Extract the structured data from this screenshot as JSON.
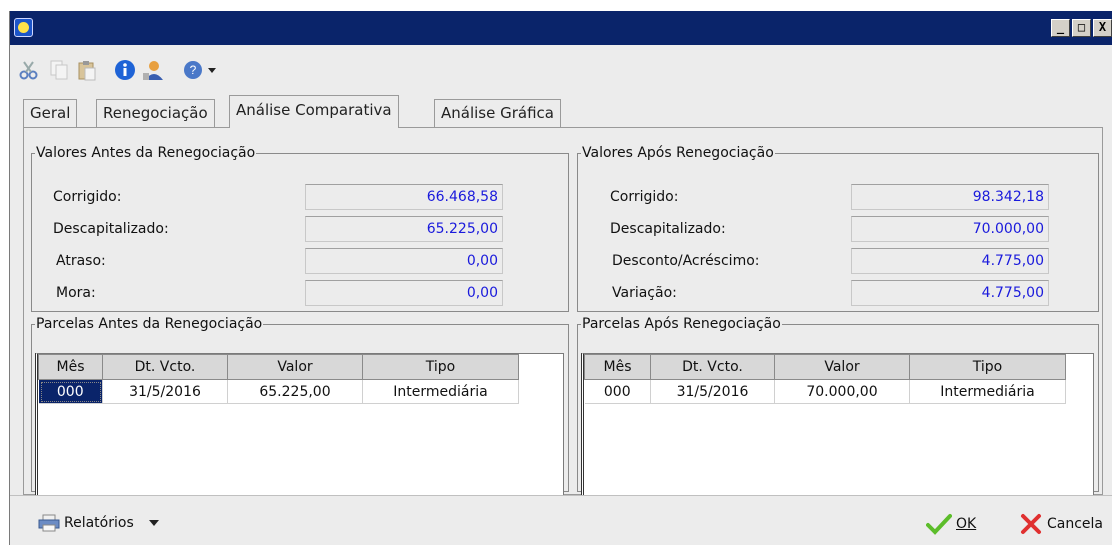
{
  "toolbar": {
    "icons": [
      "cut-icon",
      "copy-icon",
      "paste-icon",
      "info-icon",
      "user-icon",
      "help-icon",
      "dropdown-arrow-icon"
    ]
  },
  "tabs": [
    {
      "label": "Geral"
    },
    {
      "label": "Renegociação"
    },
    {
      "label": "Análise Comparativa",
      "active": true
    },
    {
      "label": "Análise Gráfica"
    }
  ],
  "antes": {
    "title": "Valores Antes da Renegociação",
    "fields": [
      {
        "label": "Corrigido:",
        "value": "66.468,58"
      },
      {
        "label": "Descapitalizado:",
        "value": "65.225,00"
      },
      {
        "label": "Atraso:",
        "value": "0,00"
      },
      {
        "label": "Mora:",
        "value": "0,00"
      }
    ]
  },
  "apos": {
    "title": "Valores Após Renegociação",
    "fields": [
      {
        "label": "Corrigido:",
        "value": "98.342,18"
      },
      {
        "label": "Descapitalizado:",
        "value": "70.000,00"
      },
      {
        "label": "Desconto/Acréscimo:",
        "value": "4.775,00"
      },
      {
        "label": "Variação:",
        "value": "4.775,00"
      }
    ]
  },
  "parcelas_antes": {
    "title": "Parcelas Antes da Renegociação",
    "columns": [
      "Mês",
      "Dt. Vcto.",
      "Valor",
      "Tipo"
    ],
    "rows": [
      [
        "000",
        "31/5/2016",
        "65.225,00",
        "Intermediária"
      ]
    ]
  },
  "parcelas_apos": {
    "title": "Parcelas Após Renegociação",
    "columns": [
      "Mês",
      "Dt. Vcto.",
      "Valor",
      "Tipo"
    ],
    "rows": [
      [
        "000",
        "31/5/2016",
        "70.000,00",
        "Intermediária"
      ]
    ]
  },
  "bottom": {
    "relatorios": "Relatórios",
    "ok": "OK",
    "cancela": "Cancela"
  },
  "window_buttons": [
    "_",
    "□",
    "X"
  ]
}
